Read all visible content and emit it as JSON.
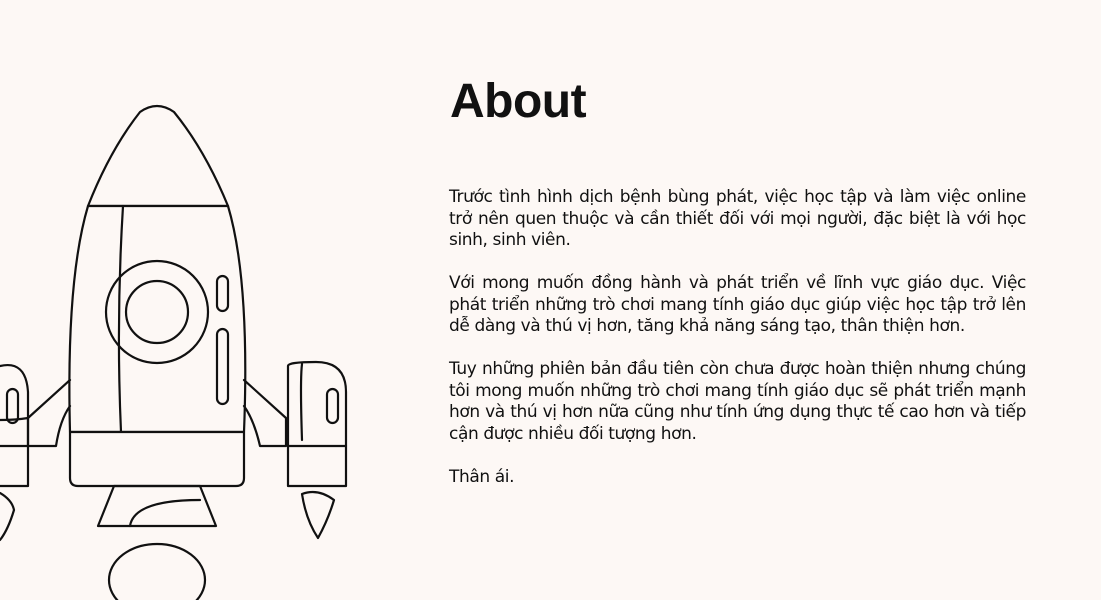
{
  "about": {
    "title": "About",
    "paragraphs": [
      "Trước tình hình dịch bệnh bùng phát, việc học tập và làm việc online trở nên quen thuộc và cần thiết đối với mọi người, đặc biệt là với học sinh, sinh viên.",
      "Với mong muốn đồng hành và phát triển về lĩnh vực giáo dục. Việc phát triển những trò chơi mang tính giáo dục giúp việc học tập trở lên dễ dàng và thú vị hơn, tăng khả năng sáng tạo, thân thiện hơn.",
      "Tuy những phiên bản đầu tiên còn chưa được hoàn thiện nhưng chúng tôi mong muốn những trò chơi mang tính giáo dục sẽ phát triển mạnh hơn và thú vị hơn nữa cũng như tính ứng dụng thực tế cao hơn và tiếp cận được nhiều đối tượng hơn.",
      "Thân ái."
    ]
  }
}
